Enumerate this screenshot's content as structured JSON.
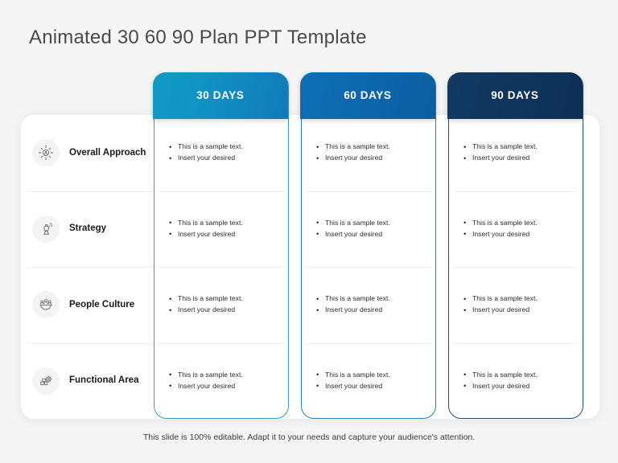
{
  "slide": {
    "title": "Animated 30 60 90 Plan PPT Template",
    "footer_note": "This slide is 100% editable. Adapt it to your needs and capture your audience's attention.",
    "background_color": "#f5f5f5",
    "panel_color": "#ffffff"
  },
  "columns": [
    {
      "label": "30 DAYS",
      "accent": "#1193c4",
      "border": "#3d9cc4"
    },
    {
      "label": "60 DAYS",
      "accent": "#0d67ac",
      "border": "#2a7fb8"
    },
    {
      "label": "90 DAYS",
      "accent": "#10355c",
      "border": "#2a5070"
    }
  ],
  "rows": [
    {
      "label": "Overall Approach",
      "icon": "network-person-icon"
    },
    {
      "label": "Strategy",
      "icon": "chess-piece-icon"
    },
    {
      "label": "People Culture",
      "icon": "people-group-icon"
    },
    {
      "label": "Functional Area",
      "icon": "puzzle-gear-icon"
    }
  ],
  "bullets": [
    "This is a sample text.",
    "Insert your desired"
  ]
}
